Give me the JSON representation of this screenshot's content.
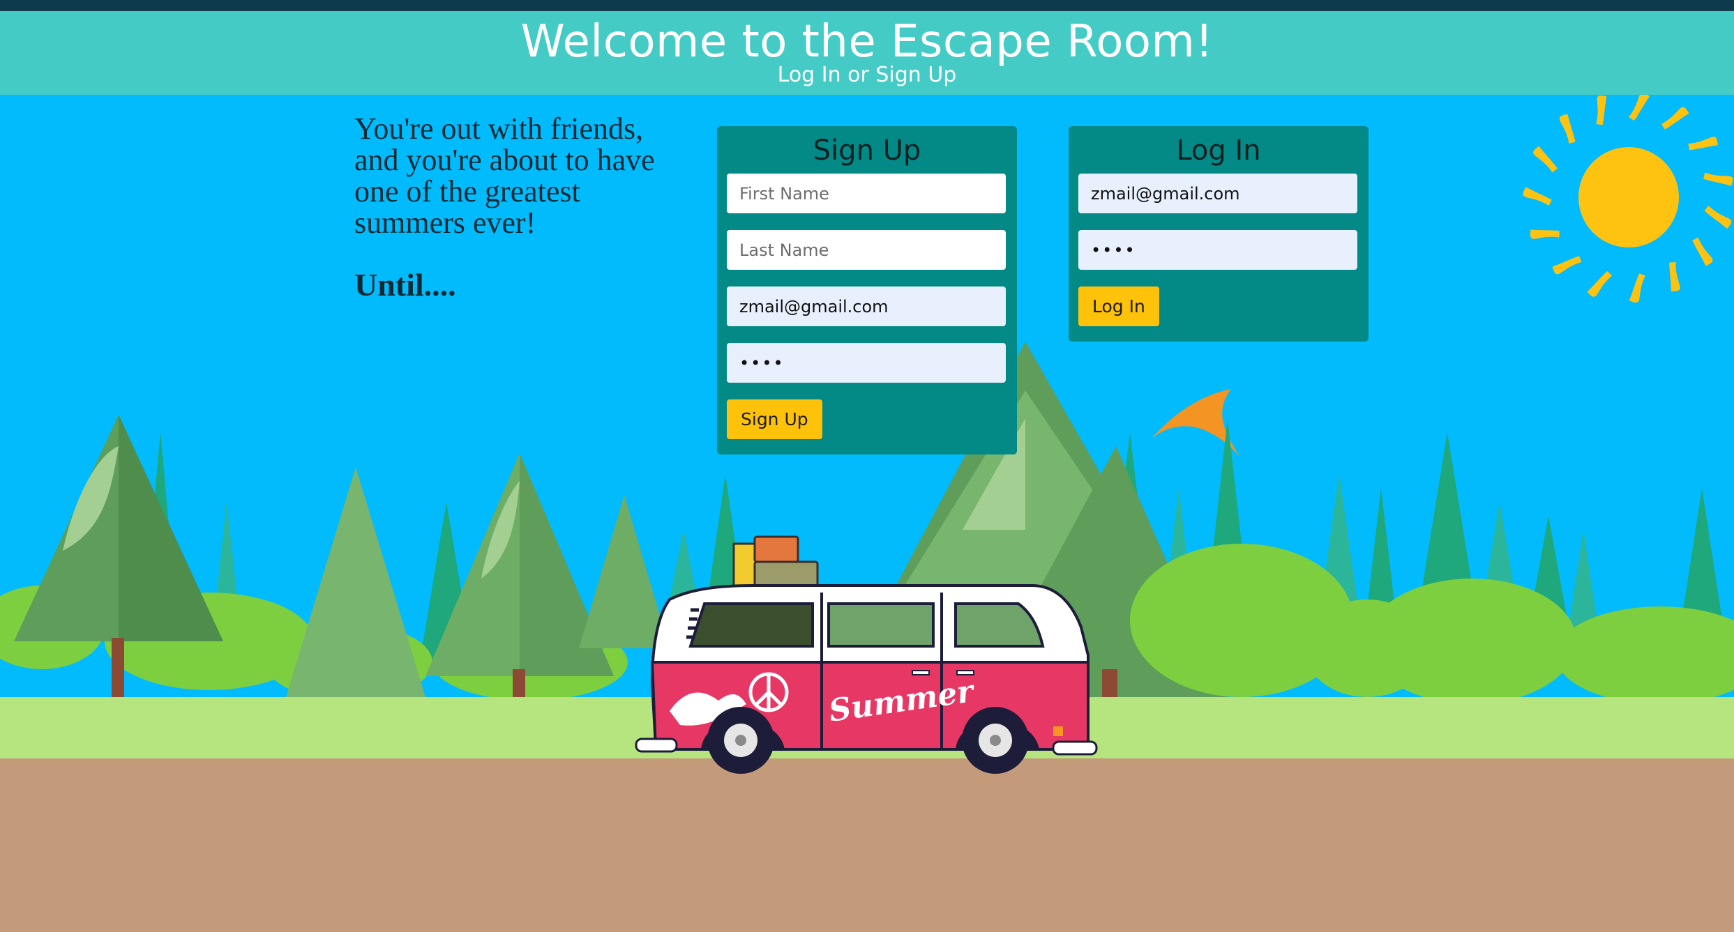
{
  "header": {
    "title": "Welcome to the Escape Room!",
    "subtitle": "Log In or Sign Up"
  },
  "intro": {
    "story": "You're out with friends, and you're about to have one of the greatest summers ever!",
    "until": "Until...."
  },
  "signup": {
    "title": "Sign Up",
    "first_name_placeholder": "First Name",
    "last_name_placeholder": "Last Name",
    "email_value": "zmail@gmail.com",
    "password_value": "••••",
    "button_label": "Sign Up"
  },
  "login": {
    "title": "Log In",
    "email_value": "zmail@gmail.com",
    "password_value": "••••",
    "button_label": "Log In"
  },
  "illustration": {
    "van_text": "Summer"
  },
  "colors": {
    "sky": "#01bbfd",
    "header": "#44cbc6",
    "panel": "#038a86",
    "button": "#fec20b",
    "ground": "#c39a7a",
    "grass": "#b6e47f",
    "sun": "#fec311"
  }
}
